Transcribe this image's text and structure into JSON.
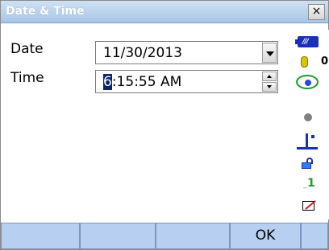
{
  "window": {
    "title": "Date & Time",
    "close_label": "×"
  },
  "form": {
    "date_label": "Date",
    "date_value": "11/30/2013",
    "time_label": "Time",
    "time_hour_selected": "6",
    "time_rest": ":15:55 AM"
  },
  "status": {
    "battery_icon": "battery-icon",
    "tilt_value": "0",
    "num_label": "1"
  },
  "softkeys": [
    "",
    "",
    "",
    "OK",
    ""
  ]
}
